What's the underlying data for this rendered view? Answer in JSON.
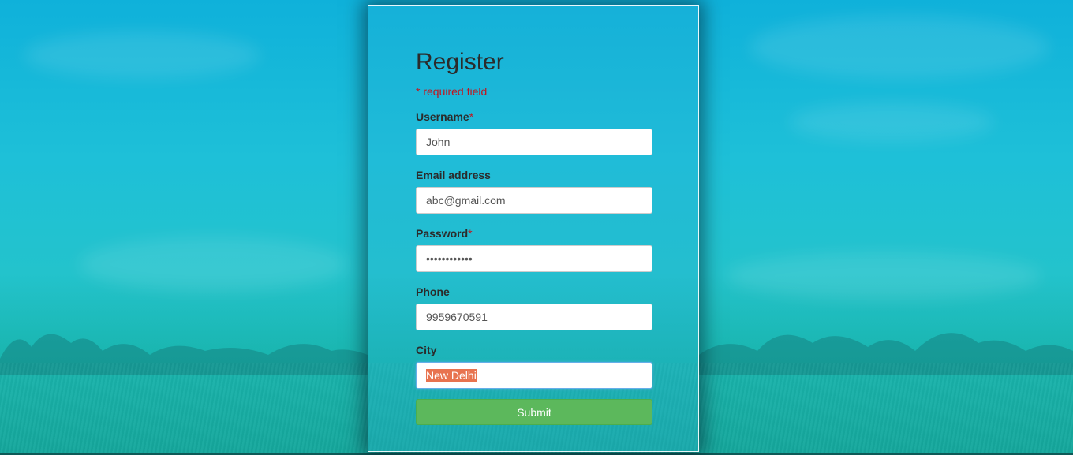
{
  "form": {
    "title": "Register",
    "required_note": "* required field",
    "star": "*",
    "fields": {
      "username": {
        "label": "Username",
        "value": "John",
        "required": true
      },
      "email": {
        "label": "Email address",
        "value": "abc@gmail.com",
        "required": false
      },
      "password": {
        "label": "Password",
        "value": "••••••••••••",
        "required": true
      },
      "phone": {
        "label": "Phone",
        "value": "9959670591",
        "required": false
      },
      "city": {
        "label": "City",
        "value": "New Delhi",
        "required": false
      }
    },
    "submit_label": "Submit"
  },
  "colors": {
    "required": "#c0161f",
    "submit": "#5cb85c",
    "selection": "#e8734f",
    "background": "#1ec0d8"
  }
}
